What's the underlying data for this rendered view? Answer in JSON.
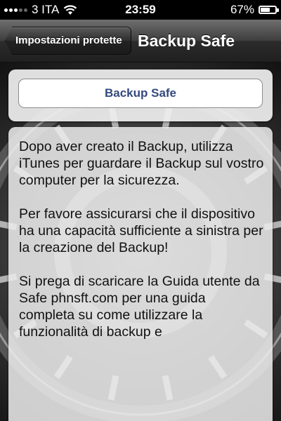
{
  "status_bar": {
    "carrier": "3 ITA",
    "time": "23:59",
    "battery_percent_label": "67%",
    "battery_level": 0.67
  },
  "nav": {
    "back_label": "Impostazioni protette",
    "title": "Backup Safe"
  },
  "header": {
    "button_label": "Backup Safe"
  },
  "info": {
    "paragraphs": [
      "Dopo aver creato il Backup, utilizza iTunes per guardare il Backup sul vostro computer per la sicurezza.",
      "Per favore assicurarsi che il dispositivo ha una capacità sufficiente a sinistra per la creazione del Backup!",
      "Si prega di scaricare la Guida utente da Safe phnsft.com per una guida completa su come utilizzare la funzionalità di backup e"
    ]
  },
  "colors": {
    "title_button_text": "#34497c",
    "nav_dark": "#202020"
  }
}
